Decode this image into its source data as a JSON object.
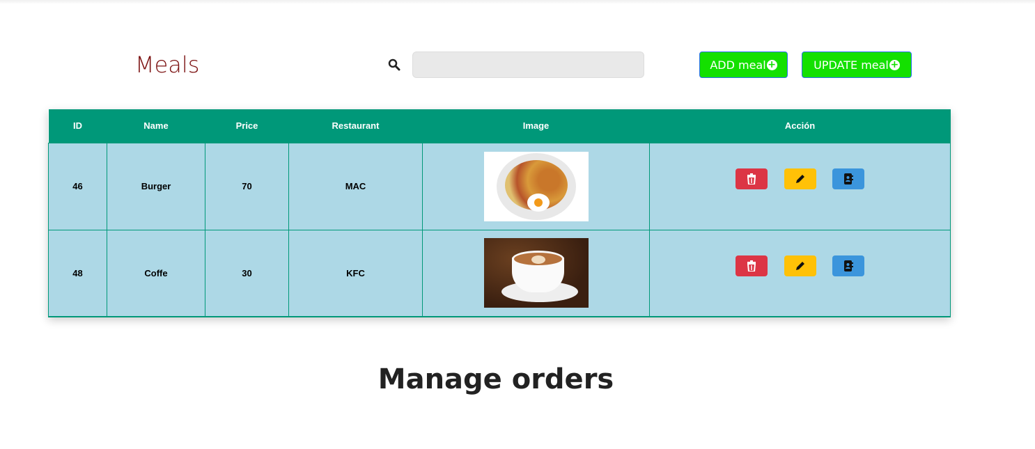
{
  "section_title": "Meals",
  "search": {
    "placeholder": "",
    "value": ""
  },
  "buttons": {
    "add": "ADD meal",
    "update": "UPDATE meal"
  },
  "table": {
    "headers": [
      "ID",
      "Name",
      "Price",
      "Restaurant",
      "Image",
      "Acción"
    ],
    "rows": [
      {
        "id": "46",
        "name": "Burger",
        "price": "70",
        "restaurant": "MAC",
        "image": "food-plate-photo"
      },
      {
        "id": "48",
        "name": "Coffe",
        "price": "30",
        "restaurant": "KFC",
        "image": "coffee-cup-photo"
      }
    ]
  },
  "orders_title": "Manage orders",
  "colors": {
    "header": "#009879",
    "row": "#add8e6",
    "green_button": "#14e000",
    "delete": "#dc3545",
    "edit": "#ffc107",
    "view": "#3b95dc",
    "title": "#7b1010"
  }
}
